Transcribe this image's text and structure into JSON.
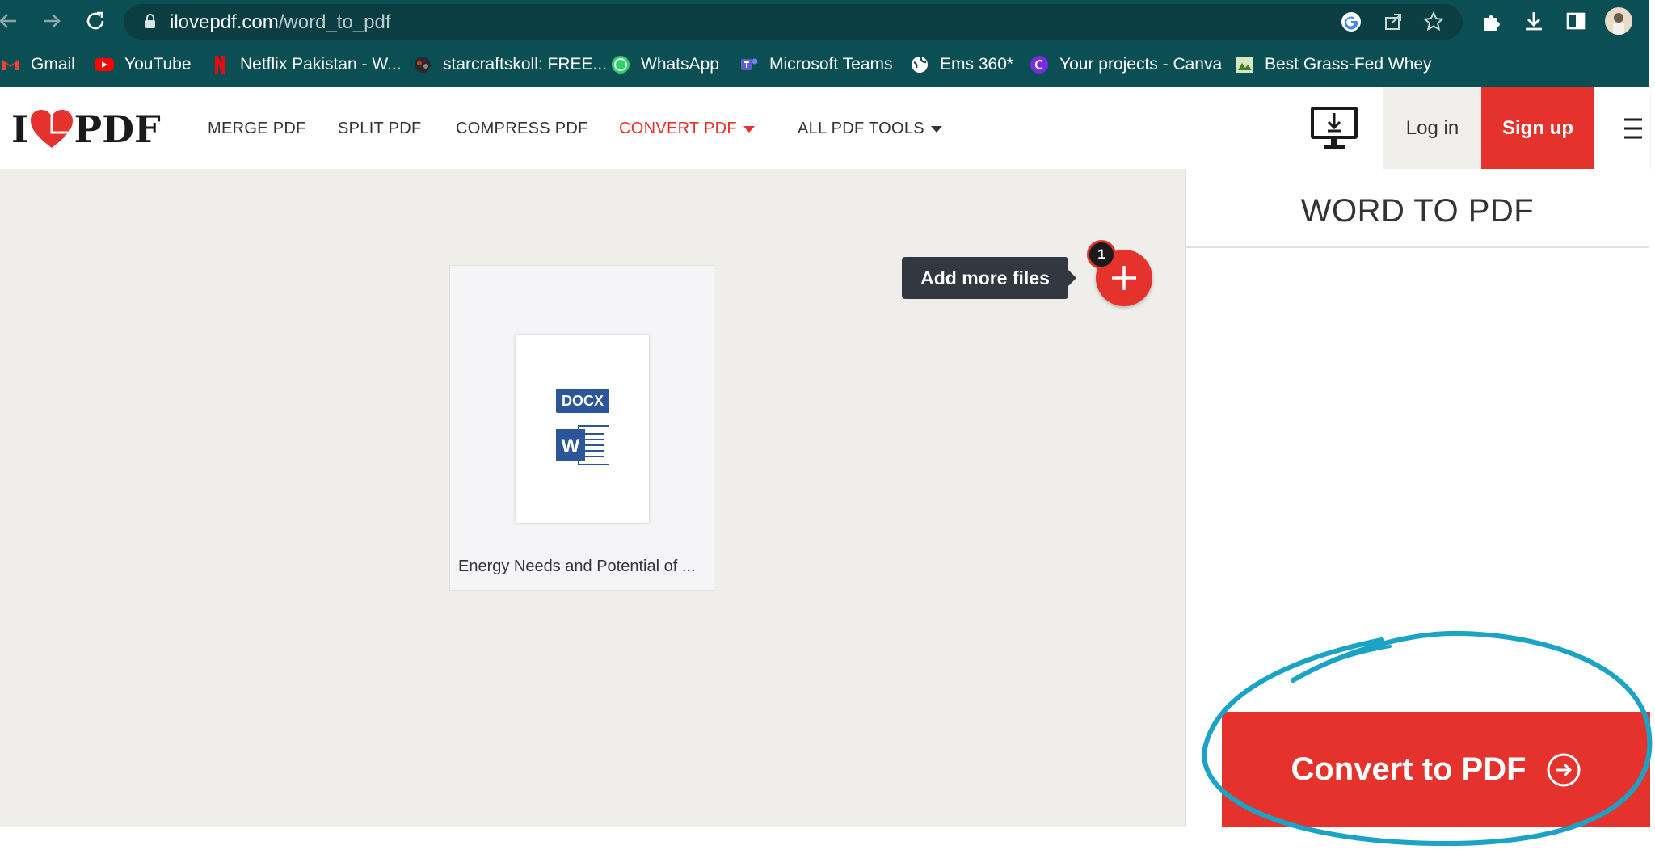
{
  "browser": {
    "url_host": "ilovepdf.com",
    "url_path": "/word_to_pdf",
    "bookmarks": [
      {
        "label": "Gmail",
        "icon": "gmail-icon"
      },
      {
        "label": "YouTube",
        "icon": "youtube-icon"
      },
      {
        "label": "Netflix Pakistan - W...",
        "icon": "netflix-icon"
      },
      {
        "label": "starcraftskoll: FREE...",
        "icon": "starcraft-icon"
      },
      {
        "label": "WhatsApp",
        "icon": "whatsapp-icon"
      },
      {
        "label": "Microsoft Teams",
        "icon": "teams-icon"
      },
      {
        "label": "Ems 360*",
        "icon": "globe-icon"
      },
      {
        "label": "Your projects - Canva",
        "icon": "canva-icon"
      },
      {
        "label": "Best Grass-Fed Whey",
        "icon": "whey-icon"
      }
    ]
  },
  "site": {
    "logo": {
      "left": "I",
      "right": "PDF"
    },
    "menu": [
      {
        "label": "MERGE PDF"
      },
      {
        "label": "SPLIT PDF"
      },
      {
        "label": "COMPRESS PDF"
      },
      {
        "label": "CONVERT PDF",
        "active": true
      },
      {
        "label": "ALL PDF TOOLS"
      }
    ],
    "login": "Log in",
    "signup": "Sign up",
    "accent": "#e5322d"
  },
  "workspace": {
    "file": {
      "type_label": "DOCX",
      "app_letter": "W",
      "name": "Energy Needs and Potential of ..."
    },
    "tooltip": "Add more files",
    "file_count": "1"
  },
  "sidebar": {
    "title": "WORD TO PDF",
    "convert_label": "Convert to PDF"
  }
}
